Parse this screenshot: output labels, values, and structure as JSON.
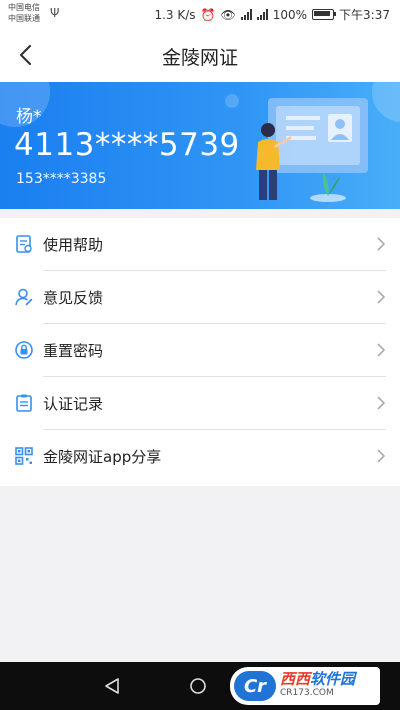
{
  "status_bar": {
    "carrier1": "中国电信",
    "carrier2": "中国联通",
    "speed": "1.3 K/s",
    "battery": "100%",
    "time": "下午3:37"
  },
  "nav": {
    "title": "金陵网证"
  },
  "profile": {
    "name": "杨*",
    "id_number": "4113****5739",
    "phone": "153****3385"
  },
  "menu": {
    "items": [
      {
        "label": "使用帮助",
        "icon": "help-doc-icon"
      },
      {
        "label": "意见反馈",
        "icon": "feedback-user-icon"
      },
      {
        "label": "重置密码",
        "icon": "reset-lock-icon"
      },
      {
        "label": "认证记录",
        "icon": "record-list-icon"
      },
      {
        "label": "金陵网证app分享",
        "icon": "qr-code-icon"
      }
    ]
  },
  "watermark": {
    "logo": "Cr",
    "title_part1": "西西",
    "title_part2": "软件园",
    "url": "CR173.COM"
  },
  "colors": {
    "banner": "#1a7ff0",
    "icon_blue": "#3a8ef0",
    "text": "#222222"
  }
}
